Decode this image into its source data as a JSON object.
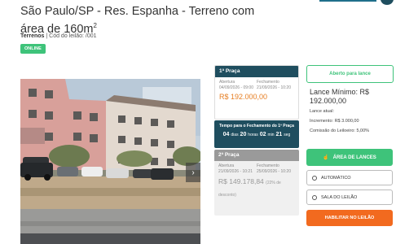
{
  "listing": {
    "title_main": "São Paulo/SP - Res. Espanha - Terreno com área de 160m",
    "title_sup": "2",
    "category": "Terrenos",
    "lot_code": " | Cód do leilão: /001",
    "badge": "ONLINE"
  },
  "first_round": {
    "title": "1ª Praça",
    "open_label": "Abertura",
    "open_date": "04/09/2026 - 09:00",
    "close_label": "Fechamento",
    "close_date": "21/09/2026 - 10:20",
    "price": "R$ 192.000,00"
  },
  "timer": {
    "label": "Tempo para o Fechamento do 1º Praça",
    "days": "04",
    "days_unit": "dias",
    "hours": "20",
    "hours_unit": "horas",
    "minutes": "02",
    "minutes_unit": "min",
    "seconds": "21",
    "seconds_unit": "seg"
  },
  "second_round": {
    "title": "2ª Praça",
    "open_label": "Abertura",
    "open_date": "21/09/2026 - 10:21",
    "close_label": "Fechamento",
    "close_date": "25/09/2026 - 10:20",
    "price": "R$ 149.178,84",
    "discount": "(22% de",
    "discount2": "desconto)"
  },
  "bidding": {
    "status": "Aberto para lance",
    "min_bid": "Lance Mínimo: R$ 192.000,00",
    "current_bid": "Lance atual:",
    "increment": "Incremento: R$ 3.000,00",
    "commission": "Comissão do Leiloeiro: 5,00%",
    "lances_button": "ÁREA DE LANCES",
    "option_auto": "AUTOMÁTICO",
    "option_room": "SALA DO LEILÃO",
    "habilitar_button": "HABILITAR NO LEILÃO"
  },
  "icons": {
    "next": "chevron-right-icon",
    "hand": "hand-pointer-icon",
    "radio": "radio-circle-icon"
  },
  "colors": {
    "brand_dark": "#1f4e5f",
    "green": "#3ec37a",
    "orange": "#f26a1f",
    "price_orange": "#e67e22"
  }
}
